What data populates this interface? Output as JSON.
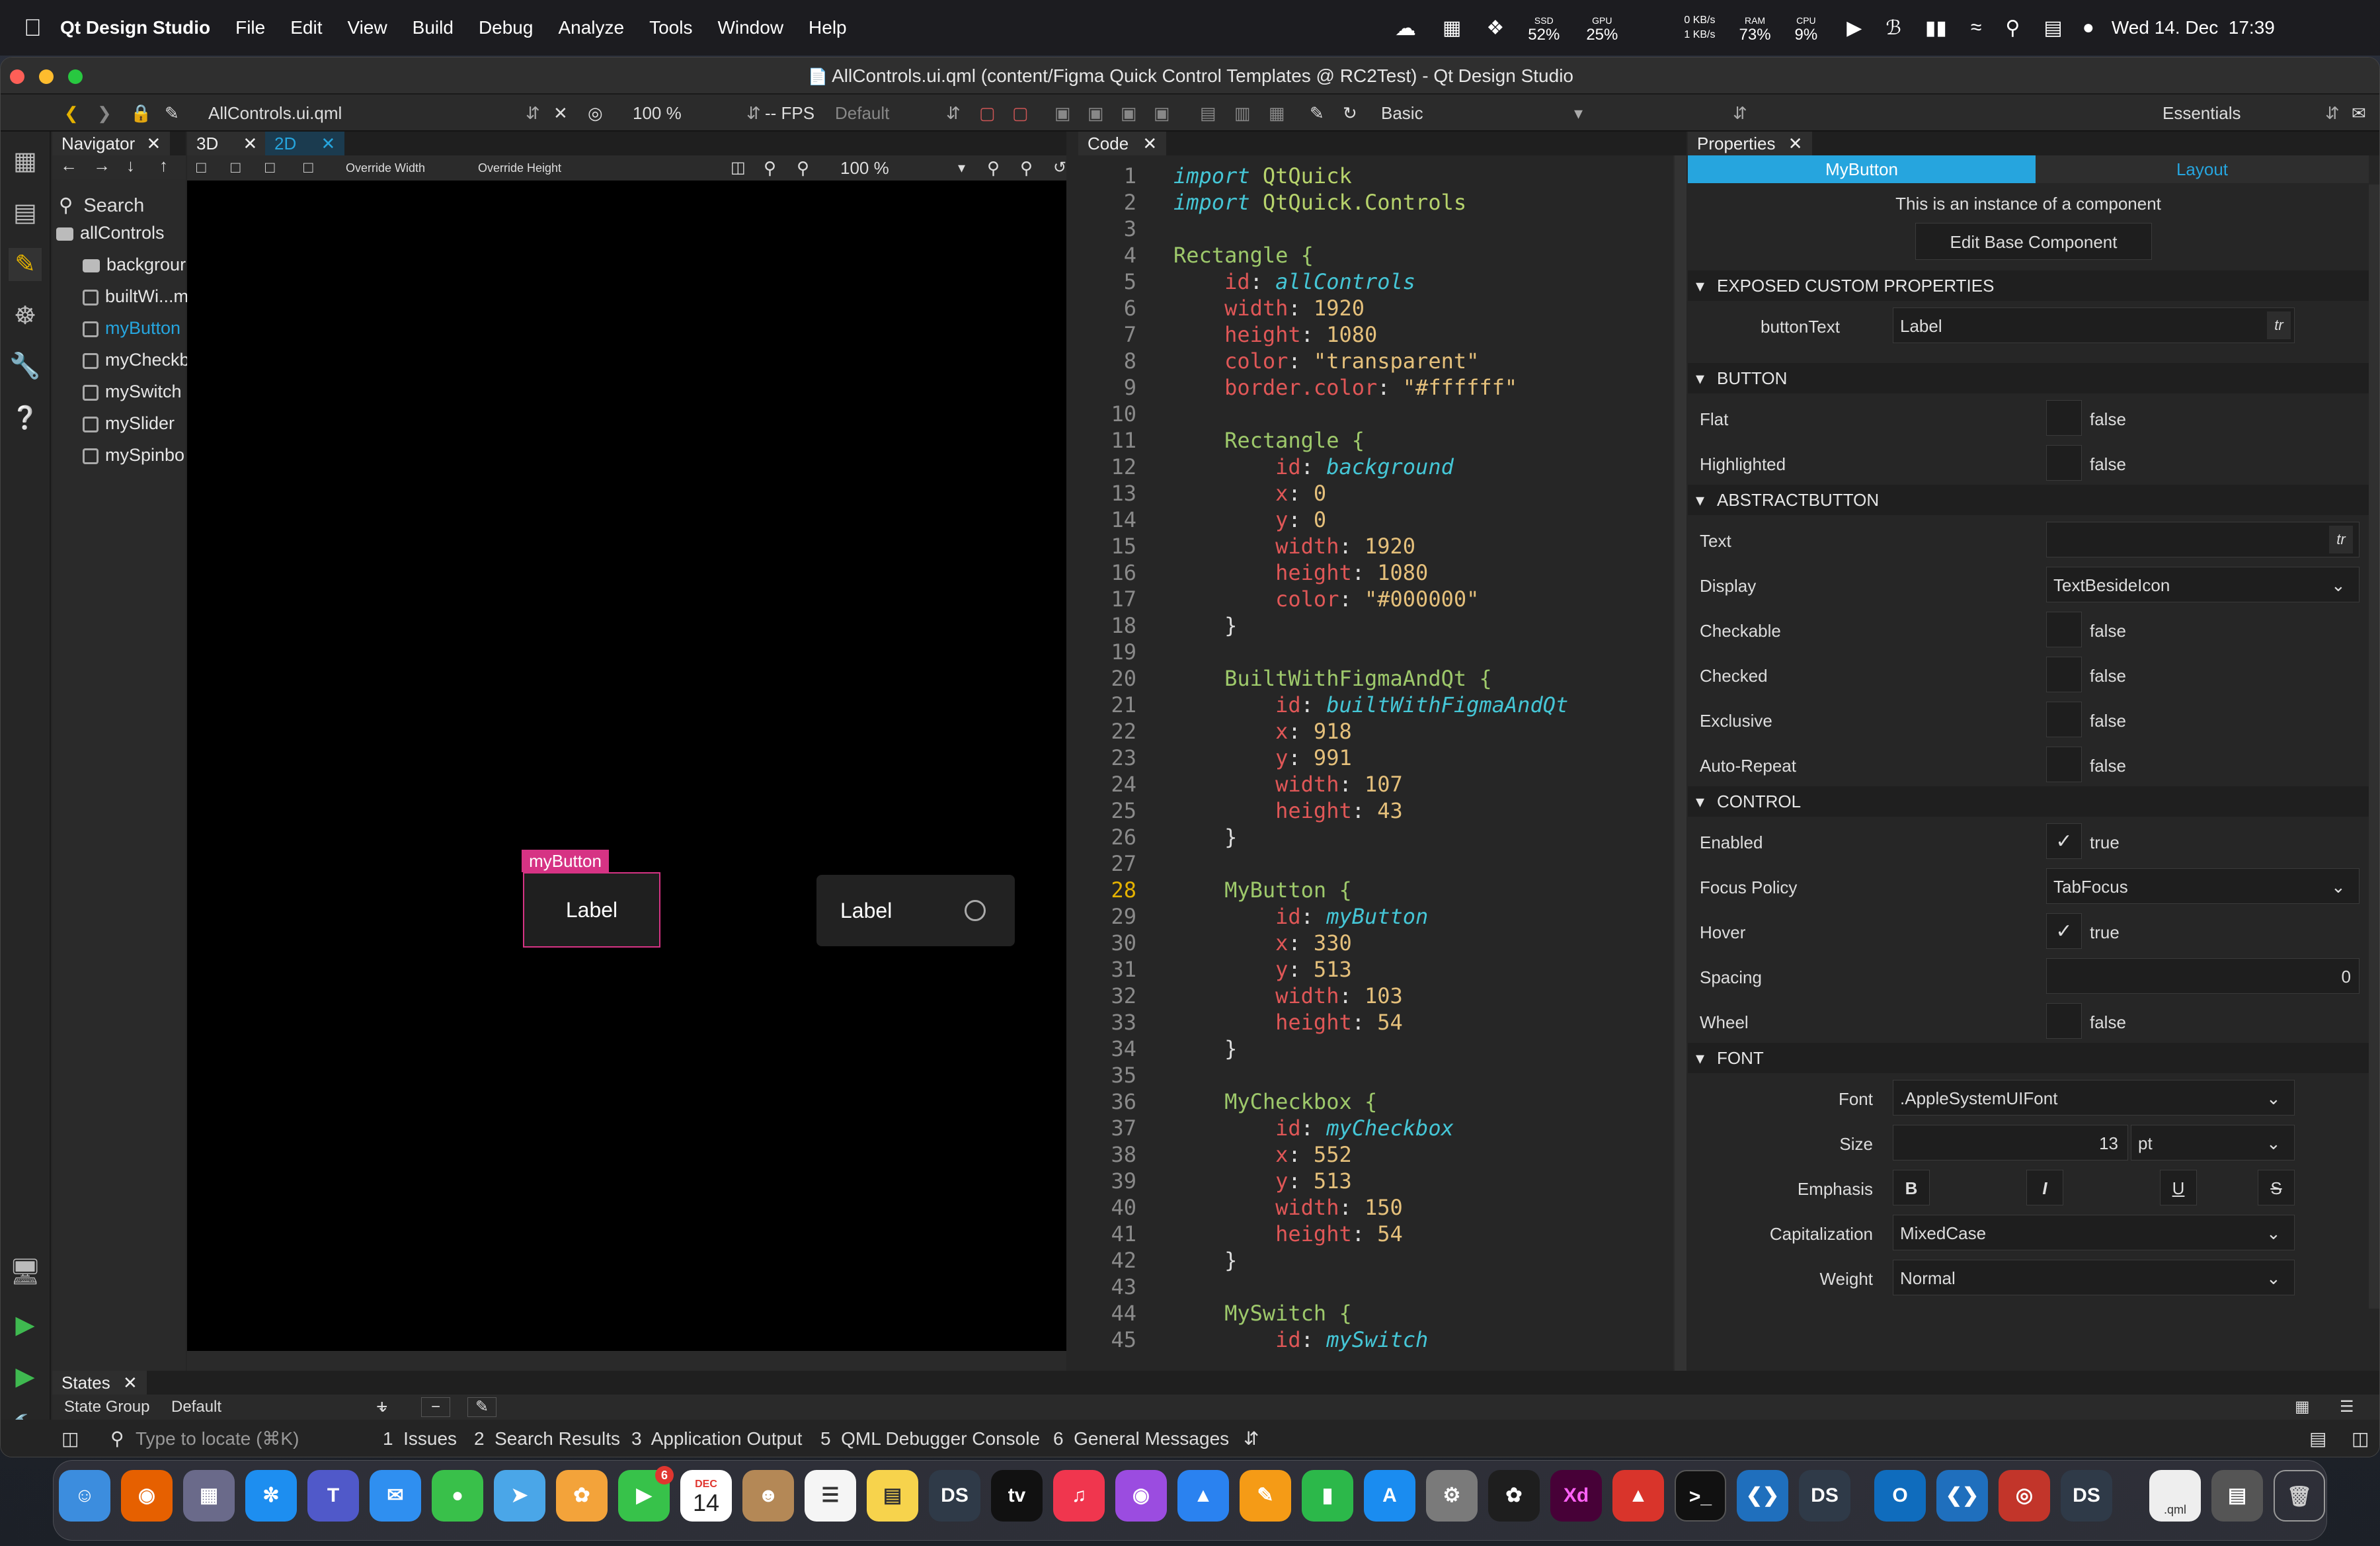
{
  "menubar": {
    "app": "Qt Design Studio",
    "items": [
      "File",
      "Edit",
      "View",
      "Build",
      "Debug",
      "Analyze",
      "Tools",
      "Window",
      "Help"
    ],
    "ssd": {
      "label": "SSD",
      "value": "52%"
    },
    "gpu": {
      "label": "GPU",
      "value": "25%"
    },
    "net": {
      "up": "0 KB/s",
      "down": "1 KB/s"
    },
    "ram": {
      "label": "RAM",
      "value": "73%"
    },
    "cpu": {
      "label": "CPU",
      "value": "9%"
    },
    "datetime": "Wed 14. Dec  17:39"
  },
  "window": {
    "title": "AllControls.ui.qml (content/Figma Quick Control Templates @ RC2Test) - Qt Design Studio"
  },
  "toolbar": {
    "file": "AllControls.ui.qml",
    "zoom": "100 %",
    "fps": "-- FPS",
    "state": "Default",
    "style": "Basic",
    "workspace": "Essentials"
  },
  "navigator": {
    "title": "Navigator",
    "search": "Search",
    "root": "allControls",
    "items": [
      "backgrour",
      "builtWi...m",
      "myButton",
      "myCheckb",
      "mySwitch",
      "mySlider",
      "mySpinbo"
    ]
  },
  "view2d": {
    "tabs": [
      "3D",
      "2D"
    ],
    "override_width": "Override Width",
    "override_height": "Override Height",
    "zoom": "100 %",
    "selection_tag": "myButton",
    "button_label": "Label",
    "checkbox_label": "Label"
  },
  "code": {
    "title": "Code",
    "lines": [
      [
        "import",
        "kw",
        " QtQuick"
      ],
      [
        "import",
        "kw",
        " QtQuick.Controls"
      ],
      [
        ""
      ],
      [
        "Rectangle {",
        "ty",
        ""
      ],
      [
        "    id: ",
        "pr",
        "allControls"
      ],
      [
        "    width: ",
        "pr",
        "1920"
      ],
      [
        "    height: ",
        "pr",
        "1080"
      ],
      [
        "    color: ",
        "pr",
        "\"transparent\""
      ],
      [
        "    border.color: ",
        "pr",
        "\"#ffffff\""
      ],
      [
        ""
      ],
      [
        "    Rectangle {",
        "ty",
        ""
      ],
      [
        "        id: ",
        "pr",
        "background"
      ],
      [
        "        x: ",
        "pr",
        "0"
      ],
      [
        "        y: ",
        "pr",
        "0"
      ],
      [
        "        width: ",
        "pr",
        "1920"
      ],
      [
        "        height: ",
        "pr",
        "1080"
      ],
      [
        "        color: ",
        "pr",
        "\"#000000\""
      ],
      [
        "    }"
      ],
      [
        ""
      ],
      [
        "    BuiltWithFigmaAndQt {",
        "ty",
        ""
      ],
      [
        "        id: ",
        "pr",
        "builtWithFigmaAndQt"
      ],
      [
        "        x: ",
        "pr",
        "918"
      ],
      [
        "        y: ",
        "pr",
        "991"
      ],
      [
        "        width: ",
        "pr",
        "107"
      ],
      [
        "        height: ",
        "pr",
        "43"
      ],
      [
        "    }"
      ],
      [
        ""
      ],
      [
        "    MyButton {",
        "ty",
        ""
      ],
      [
        "        id: ",
        "pr",
        "myButton"
      ],
      [
        "        x: ",
        "pr",
        "330"
      ],
      [
        "        y: ",
        "pr",
        "513"
      ],
      [
        "        width: ",
        "pr",
        "103"
      ],
      [
        "        height: ",
        "pr",
        "54"
      ],
      [
        "    }"
      ],
      [
        ""
      ],
      [
        "    MyCheckbox {",
        "ty",
        ""
      ],
      [
        "        id: ",
        "pr",
        "myCheckbox"
      ],
      [
        "        x: ",
        "pr",
        "552"
      ],
      [
        "        y: ",
        "pr",
        "513"
      ],
      [
        "        width: ",
        "pr",
        "150"
      ],
      [
        "        height: ",
        "pr",
        "54"
      ],
      [
        "    }"
      ],
      [
        ""
      ],
      [
        "    MySwitch {",
        "ty",
        ""
      ],
      [
        "        id: ",
        "pr",
        "mySwitch"
      ]
    ]
  },
  "properties": {
    "title": "Properties",
    "tab_component": "MyButton",
    "tab_layout": "Layout",
    "instance_note": "This is an instance of a component",
    "edit_base": "Edit Base Component",
    "sections": {
      "exposed": "EXPOSED CUSTOM PROPERTIES",
      "button": "BUTTON",
      "abstract": "ABSTRACTBUTTON",
      "control": "CONTROL",
      "font": "FONT"
    },
    "buttonText": {
      "label": "buttonText",
      "value": "Label"
    },
    "flat": {
      "label": "Flat",
      "value": "false"
    },
    "highlighted": {
      "label": "Highlighted",
      "value": "false"
    },
    "text": {
      "label": "Text",
      "value": ""
    },
    "display": {
      "label": "Display",
      "value": "TextBesideIcon"
    },
    "checkable": {
      "label": "Checkable",
      "value": "false"
    },
    "checked": {
      "label": "Checked",
      "value": "false"
    },
    "exclusive": {
      "label": "Exclusive",
      "value": "false"
    },
    "autorepeat": {
      "label": "Auto-Repeat",
      "value": "false"
    },
    "enabled": {
      "label": "Enabled",
      "value": "true"
    },
    "focus": {
      "label": "Focus Policy",
      "value": "TabFocus"
    },
    "hover": {
      "label": "Hover",
      "value": "true"
    },
    "spacing": {
      "label": "Spacing",
      "value": "0"
    },
    "wheel": {
      "label": "Wheel",
      "value": "false"
    },
    "font": {
      "label": "Font",
      "value": ".AppleSystemUIFont"
    },
    "size": {
      "label": "Size",
      "value": "13",
      "unit": "pt"
    },
    "emphasis": {
      "label": "Emphasis",
      "bold": "B",
      "italic": "I",
      "underline": "U",
      "strike": "S"
    },
    "capitalization": {
      "label": "Capitalization",
      "value": "MixedCase"
    },
    "weight": {
      "label": "Weight",
      "value": "Normal"
    },
    "tr": "tr"
  },
  "states": {
    "title": "States",
    "group_label": "State Group",
    "group_value": "Default"
  },
  "statusbar": {
    "locate": "Type to locate (⌘K)",
    "tabs": [
      "1  Issues",
      "2  Search Results",
      "3  Application Output",
      "5  QML Debugger Console",
      "6  General Messages"
    ]
  },
  "dock": {
    "ds": "DS",
    "xd": "Xd",
    "tv": "tv",
    "cal_month": "DEC",
    "cal_day": "14",
    "badge": "6",
    "qml": ".qml"
  },
  "colors": {
    "accent": "#26a5de",
    "selection": "#d63384",
    "bg": "#262626"
  }
}
